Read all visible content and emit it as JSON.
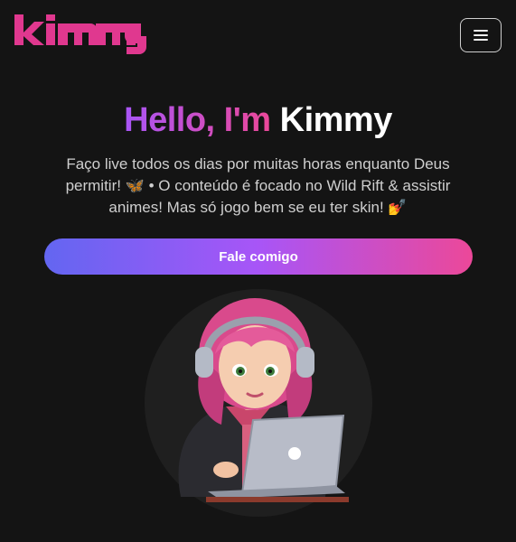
{
  "header": {
    "logo_text": "kimmy",
    "menu_icon": "hamburger-menu-icon"
  },
  "hero": {
    "greeting": "Hello, I'm",
    "name": "Kimmy",
    "description": "Faço live todos os dias por muitas horas enquanto Deus permitir! 🦋 • O conteúdo é focado no Wild Rift & assistir animes! Mas só jogo bem se eu ter skin! 💅",
    "cta_label": "Fale comigo"
  },
  "colors": {
    "background": "#141414",
    "logo": "#e0388f",
    "gradient_start": "#6366f1",
    "gradient_mid": "#a855f7",
    "gradient_end": "#ec4899"
  }
}
